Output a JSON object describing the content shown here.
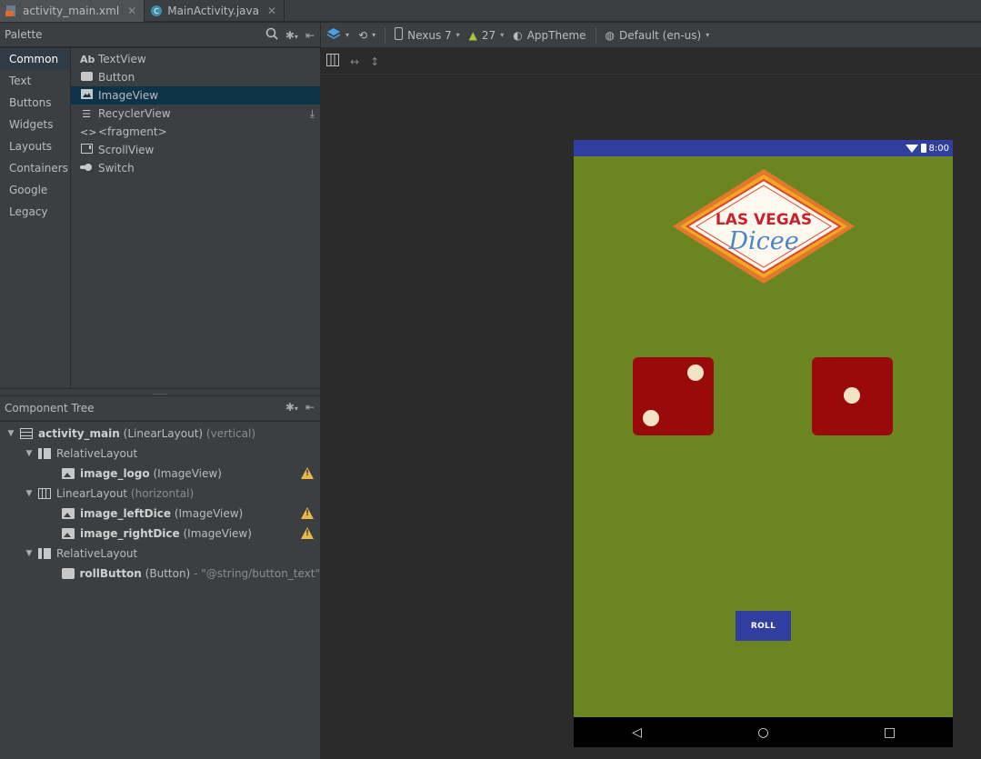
{
  "tabs": [
    {
      "label": "activity_main.xml",
      "active": true
    },
    {
      "label": "MainActivity.java",
      "active": false
    }
  ],
  "palette": {
    "title": "Palette",
    "categories": [
      "Common",
      "Text",
      "Buttons",
      "Widgets",
      "Layouts",
      "Containers",
      "Google",
      "Legacy"
    ],
    "selected_category": "Common",
    "widgets": [
      {
        "label": "TextView",
        "icon": "Ab"
      },
      {
        "label": "Button",
        "icon": "button-icon"
      },
      {
        "label": "ImageView",
        "icon": "image-icon"
      },
      {
        "label": "RecyclerView",
        "icon": "list-icon"
      },
      {
        "label": "<fragment>",
        "icon": "code-icon"
      },
      {
        "label": "ScrollView",
        "icon": "scroll-icon"
      },
      {
        "label": "Switch",
        "icon": "switch-icon"
      }
    ],
    "selected_widget": "ImageView"
  },
  "component_tree": {
    "title": "Component Tree",
    "nodes": [
      {
        "name": "activity_main",
        "type": "(LinearLayout)",
        "extra": "(vertical)"
      },
      {
        "name": "RelativeLayout"
      },
      {
        "name": "image_logo",
        "type": "(ImageView)"
      },
      {
        "name": "LinearLayout",
        "extra": "(horizontal)"
      },
      {
        "name": "image_leftDice",
        "type": "(ImageView)"
      },
      {
        "name": "image_rightDice",
        "type": "(ImageView)"
      },
      {
        "name": "RelativeLayout"
      },
      {
        "name": "rollButton",
        "type": "(Button)",
        "extra": "- \"@string/button_text\""
      }
    ]
  },
  "toolbar": {
    "device": "Nexus 7",
    "api": "27",
    "theme": "AppTheme",
    "locale": "Default (en-us)"
  },
  "device": {
    "time": "8:00",
    "logo_line1": "LAS VEGAS",
    "logo_line2": "Dicee",
    "button_label": "ROLL"
  },
  "colors": {
    "status_bar": "#303f9f",
    "felt_green": "#6b8620",
    "dice_red": "#9b0a0a",
    "pip": "#f1e3c4",
    "warning": "#e8b84a"
  }
}
